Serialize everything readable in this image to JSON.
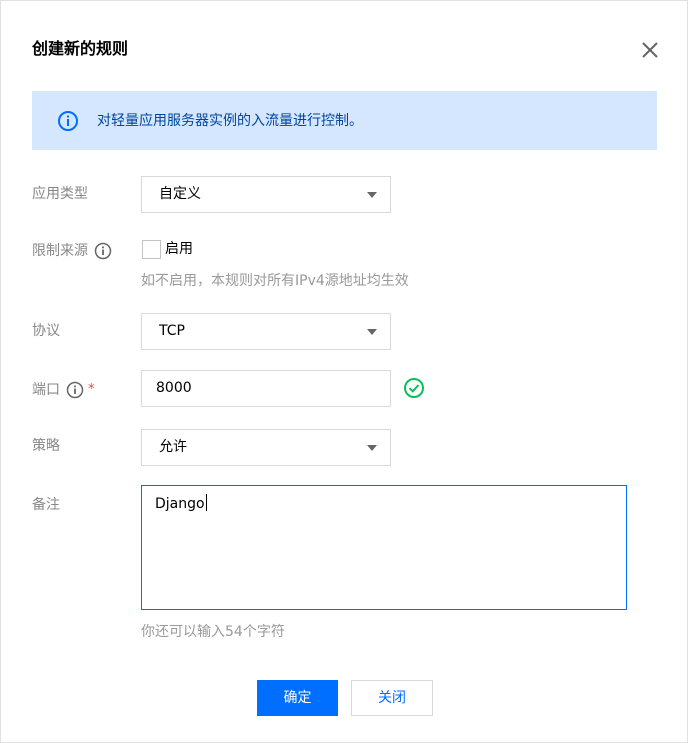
{
  "dialog": {
    "title": "创建新的规则",
    "close_icon": "close-icon"
  },
  "notice": {
    "icon": "info-icon",
    "text": "对轻量应用服务器实例的入流量进行控制。",
    "colors": {
      "background": "#d5e7ff",
      "text": "#00449e"
    }
  },
  "form": {
    "app_type": {
      "label": "应用类型",
      "value": "自定义"
    },
    "source_limit": {
      "label": "限制来源",
      "checkbox_label": "启用",
      "checked": false,
      "hint": "如不启用，本规则对所有IPv4源地址均生效"
    },
    "protocol": {
      "label": "协议",
      "value": "TCP"
    },
    "port": {
      "label": "端口",
      "required_mark": "*",
      "value": "8000",
      "valid_icon": "check-circle-icon"
    },
    "policy": {
      "label": "策略",
      "value": "允许"
    },
    "remark": {
      "label": "备注",
      "value": "Django",
      "hint": "你还可以输入54个字符"
    }
  },
  "footer": {
    "confirm_label": "确定",
    "close_label": "关闭"
  },
  "colors": {
    "primary": "#006eff",
    "success": "#0abf5b",
    "required": "#e54545"
  }
}
